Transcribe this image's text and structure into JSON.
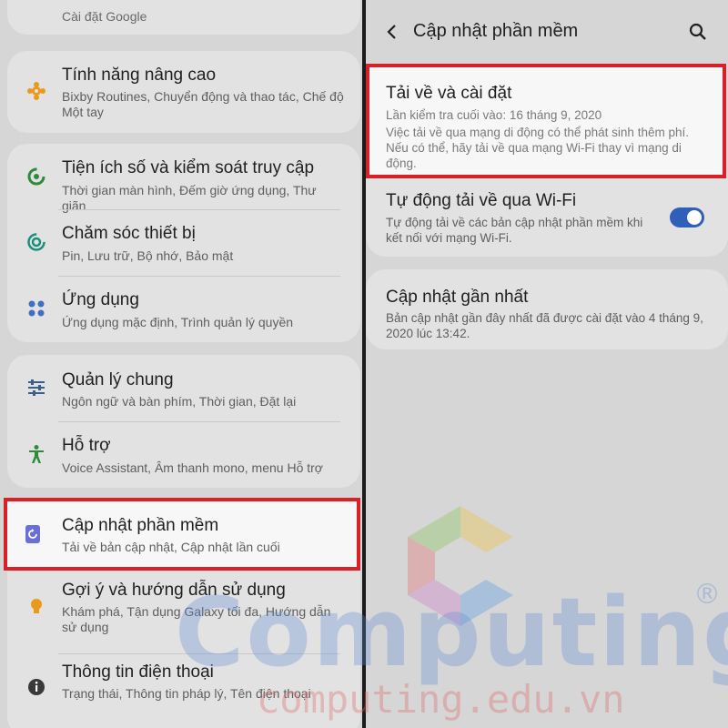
{
  "left": {
    "top_partial_sub": "Cài đặt Google",
    "items": [
      {
        "title": "Tính năng nâng cao",
        "sub": "Bixby Routines, Chuyển động và thao tác, Chế độ Một tay"
      },
      {
        "title": "Tiện ích số và kiểm soát truy cập",
        "sub": "Thời gian màn hình, Đếm giờ ứng dụng, Thư giãn"
      },
      {
        "title": "Chăm sóc thiết bị",
        "sub": "Pin, Lưu trữ, Bộ nhớ, Bảo mật"
      },
      {
        "title": "Ứng dụng",
        "sub": "Ứng dụng mặc định, Trình quản lý quyền"
      },
      {
        "title": "Quản lý chung",
        "sub": "Ngôn ngữ và bàn phím, Thời gian, Đặt lại"
      },
      {
        "title": "Hỗ trợ",
        "sub": "Voice Assistant, Âm thanh mono, menu Hỗ trợ"
      },
      {
        "title": "Cập nhật phần mềm",
        "sub": "Tải về bản cập nhật, Cập nhật lần cuối"
      },
      {
        "title": "Gợi ý và hướng dẫn sử dụng",
        "sub": "Khám phá, Tận dụng Galaxy tối đa, Hướng dẫn sử dụng"
      },
      {
        "title": "Thông tin điện thoại",
        "sub": "Trạng thái, Thông tin pháp lý, Tên điện thoại"
      }
    ]
  },
  "right": {
    "header_title": "Cập nhật phần mềm",
    "download": {
      "title": "Tải về và cài đặt",
      "last_checked": "Lần kiểm tra cuối vào: 16 tháng 9, 2020",
      "note": "Việc tải về qua mạng di động có thể phát sinh thêm phí. Nếu có thể, hãy tải về qua mạng Wi-Fi thay vì mạng di động."
    },
    "auto_wifi": {
      "title": "Tự động tải về qua Wi-Fi",
      "sub": "Tự động tải về các bản cập nhật phần mềm khi kết nối với mạng Wi-Fi.",
      "enabled": true
    },
    "last_update": {
      "title": "Cập nhật gần nhất",
      "sub": "Bản cập nhật gần đây nhất đã được cài đặt vào 4 tháng 9, 2020 lúc 13:42."
    }
  },
  "watermark": {
    "brand": "Computing",
    "site": "computing.edu.vn",
    "registered": "®"
  },
  "colors": {
    "highlight": "#d92027",
    "toggle_on": "#2f5fb8",
    "icon_orange": "#e99a1c",
    "icon_green": "#2f8a3e",
    "icon_teal": "#1a8f7c",
    "icon_blue": "#3f6fc4",
    "icon_purple": "#6a6fd6"
  }
}
